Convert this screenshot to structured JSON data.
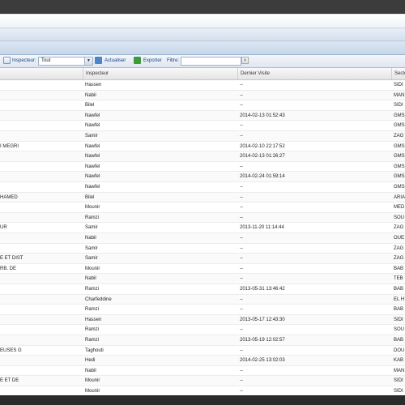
{
  "toolbar": {
    "inspector_label": "Inspecteur:",
    "inspector_value": "Tout",
    "refresh_label": "Actualiser",
    "export_label": "Exporter",
    "filter_label": "Filtre:",
    "clear_label": "×"
  },
  "grid": {
    "columns": [
      "",
      "Inspecteur",
      "Dernier Visite",
      "Secte"
    ],
    "rows": [
      [
        "",
        "Hassen",
        "--",
        "SIDI"
      ],
      [
        "",
        "Nabil",
        "--",
        "MAN"
      ],
      [
        "",
        "Bilel",
        "--",
        "SIDI"
      ],
      [
        "",
        "Nawfel",
        "2014-02-13 01:52:43",
        "GMS"
      ],
      [
        "",
        "Nawfel",
        "--",
        "GMS"
      ],
      [
        "",
        "Samir",
        "--",
        "ZAG"
      ],
      [
        "I MEGRI",
        "Nawfel",
        "2014-02-10 22:17:52",
        "GMS"
      ],
      [
        "",
        "Nawfel",
        "2014-02-13 01:26:27",
        "GMS"
      ],
      [
        "",
        "Nawfel",
        "--",
        "GMS"
      ],
      [
        "",
        "Nawfel",
        "2014-02-24 01:59:14",
        "GMS"
      ],
      [
        "",
        "Nawfel",
        "--",
        "GMS"
      ],
      [
        "HAMED",
        "Bilel",
        "--",
        "ARIA"
      ],
      [
        "",
        "Mounir",
        "--",
        "MED"
      ],
      [
        "",
        "Ramzi",
        "--",
        "SOU"
      ],
      [
        "UR",
        "Samir",
        "2013-11-20 11:14:44",
        "ZAG"
      ],
      [
        "",
        "Nabil",
        "--",
        "OUE"
      ],
      [
        "",
        "Samir",
        "--",
        "ZAG"
      ],
      [
        "E ET DIST",
        "Samir",
        "--",
        "ZAG"
      ],
      [
        "RB. DE",
        "Mounir",
        "--",
        "BAB"
      ],
      [
        "",
        "Nabil",
        "--",
        "TEB"
      ],
      [
        "",
        "Ramzi",
        "2013-05-31 13:46:42",
        "BAB"
      ],
      [
        "",
        "Charfeddine",
        "--",
        "EL H"
      ],
      [
        "",
        "Ramzi",
        "--",
        "BAB"
      ],
      [
        "",
        "Hassen",
        "2013-05-17 12:43:30",
        "SIDI"
      ],
      [
        "",
        "Ramzi",
        "--",
        "SOU"
      ],
      [
        "",
        "Ramzi",
        "2013-05-19 12:02:57",
        "BAB"
      ],
      [
        "EUSES G",
        "Taghouti",
        "--",
        "DOU"
      ],
      [
        "",
        "Hedi",
        "2014-02-25 13:02:03",
        "KAB"
      ],
      [
        "",
        "Nabil",
        "--",
        "MAN"
      ],
      [
        "E ET DE",
        "Mounir",
        "--",
        "SIDI"
      ],
      [
        "",
        "Mounir",
        "--",
        "SIDI"
      ]
    ]
  }
}
